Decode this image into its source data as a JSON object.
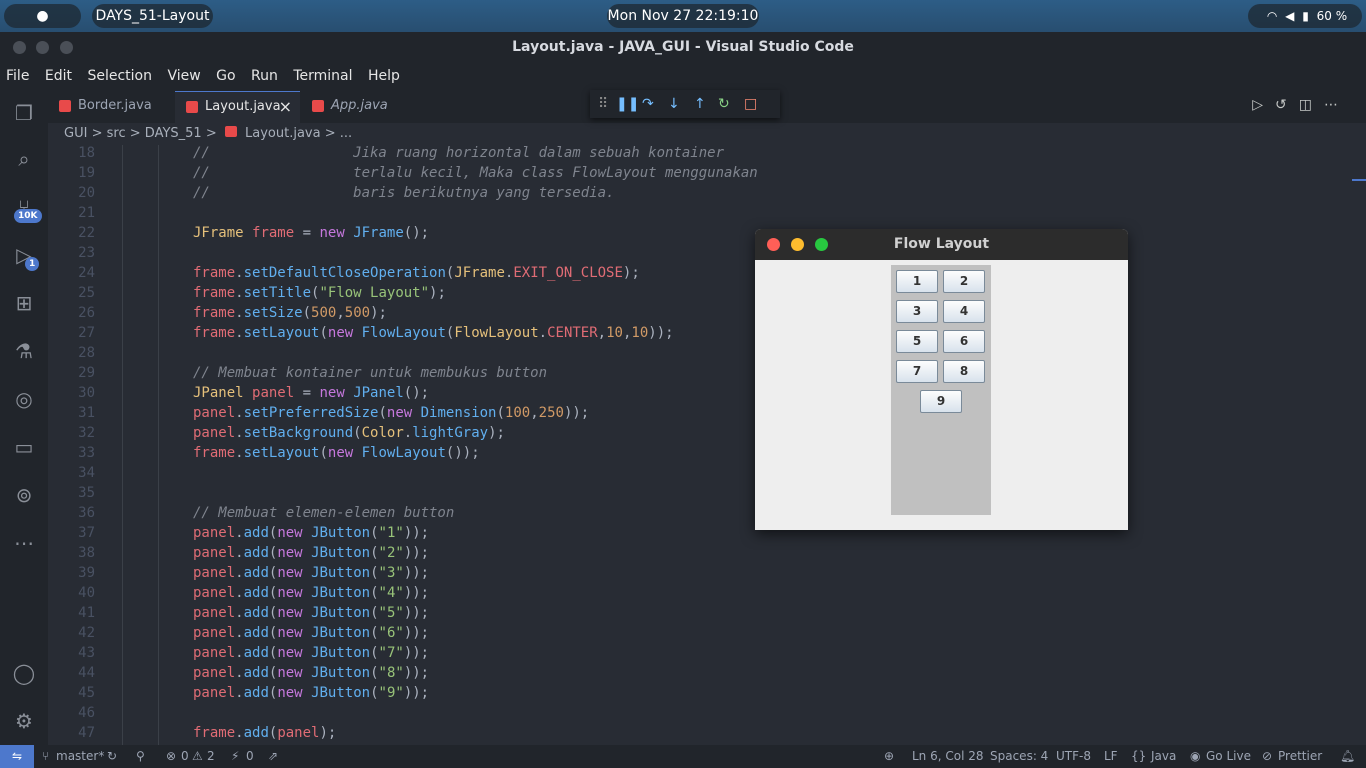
{
  "system": {
    "app_name": "DAYS_51-Layout",
    "clock": "Mon Nov 27  22:19:10",
    "battery": "60 %"
  },
  "window": {
    "title": "Layout.java - JAVA_GUI - Visual Studio Code"
  },
  "menu": [
    "File",
    "Edit",
    "Selection",
    "View",
    "Go",
    "Run",
    "Terminal",
    "Help"
  ],
  "activity_badges": {
    "source_control": "10K",
    "run_debug": "1"
  },
  "tabs": [
    {
      "label": "Border.java"
    },
    {
      "label": "Layout.java",
      "close": "×"
    },
    {
      "label": "App.java"
    }
  ],
  "breadcrumb": [
    "GUI",
    ">",
    "src",
    ">",
    "DAYS_51",
    ">",
    "Layout.java",
    ">",
    "..."
  ],
  "editor": {
    "lines": [
      {
        "n": "18"
      },
      {
        "n": "19"
      },
      {
        "n": "20"
      },
      {
        "n": "21"
      },
      {
        "n": "22"
      },
      {
        "n": "23"
      },
      {
        "n": "24"
      },
      {
        "n": "25"
      },
      {
        "n": "26"
      },
      {
        "n": "27"
      },
      {
        "n": "28"
      },
      {
        "n": "29"
      },
      {
        "n": "30"
      },
      {
        "n": "31"
      },
      {
        "n": "32"
      },
      {
        "n": "33"
      },
      {
        "n": "34"
      },
      {
        "n": "35"
      },
      {
        "n": "36"
      },
      {
        "n": "37"
      },
      {
        "n": "38"
      },
      {
        "n": "39"
      },
      {
        "n": "40"
      },
      {
        "n": "41"
      },
      {
        "n": "42"
      },
      {
        "n": "43"
      },
      {
        "n": "44"
      },
      {
        "n": "45"
      },
      {
        "n": "46"
      },
      {
        "n": "47"
      }
    ]
  },
  "swing": {
    "title": "Flow Layout",
    "buttons": [
      "1",
      "2",
      "3",
      "4",
      "5",
      "6",
      "7",
      "8",
      "9"
    ]
  },
  "status": {
    "branch": "master*",
    "errors": "0",
    "warnings": "2",
    "ports": "0",
    "position": "Ln 6, Col 28",
    "spaces": "Spaces: 4",
    "encoding": "UTF-8",
    "eol": "LF",
    "language": "Java",
    "golive": "Go Live",
    "prettier": "Prettier"
  },
  "colors": {
    "accent": "#4d78cc",
    "editor_bg": "#282c34"
  }
}
